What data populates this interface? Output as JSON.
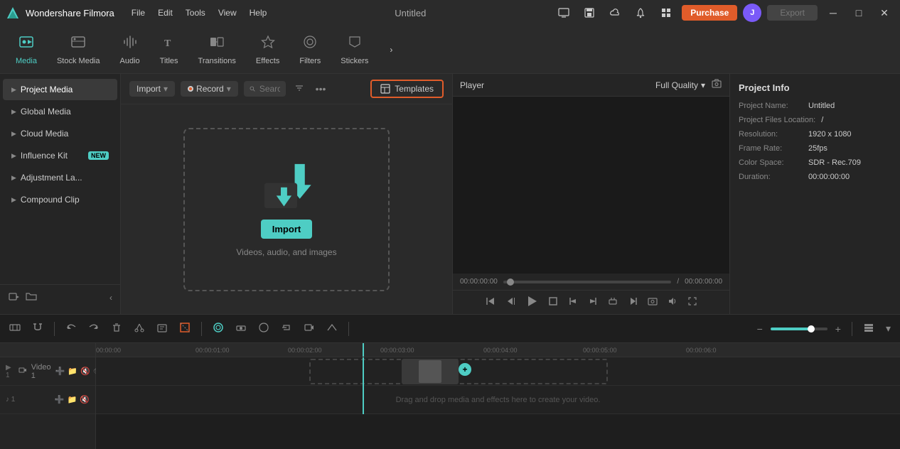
{
  "app": {
    "name": "Wondershare Filmora",
    "title": "Untitled"
  },
  "titlebar": {
    "menu": [
      "File",
      "Edit",
      "Tools",
      "View",
      "Help"
    ],
    "purchase_label": "Purchase",
    "export_label": "Export",
    "user_initial": "J",
    "win_controls": [
      "–",
      "□",
      "✕"
    ]
  },
  "toolbar": {
    "items": [
      {
        "id": "media",
        "icon": "⬛",
        "label": "Media",
        "active": true
      },
      {
        "id": "stock-media",
        "icon": "🎬",
        "label": "Stock Media"
      },
      {
        "id": "audio",
        "icon": "♪",
        "label": "Audio"
      },
      {
        "id": "titles",
        "icon": "T",
        "label": "Titles"
      },
      {
        "id": "transitions",
        "icon": "◧",
        "label": "Transitions"
      },
      {
        "id": "effects",
        "icon": "✦",
        "label": "Effects"
      },
      {
        "id": "filters",
        "icon": "◉",
        "label": "Filters"
      },
      {
        "id": "stickers",
        "icon": "★",
        "label": "Stickers"
      }
    ],
    "more_icon": "›"
  },
  "sidebar": {
    "items": [
      {
        "id": "project-media",
        "label": "Project Media",
        "active": true
      },
      {
        "id": "global-media",
        "label": "Global Media"
      },
      {
        "id": "cloud-media",
        "label": "Cloud Media"
      },
      {
        "id": "influence-kit",
        "label": "Influence Kit",
        "badge": "NEW"
      },
      {
        "id": "adjustment-la",
        "label": "Adjustment La..."
      },
      {
        "id": "compound-clip",
        "label": "Compound Clip"
      }
    ],
    "bottom_icons": [
      "➕",
      "📁"
    ]
  },
  "content_toolbar": {
    "import_label": "Import",
    "record_label": "Record",
    "search_placeholder": "Search media",
    "templates_label": "Templates"
  },
  "import_area": {
    "import_btn_label": "Import",
    "subtext": "Videos, audio, and images"
  },
  "player": {
    "label": "Player",
    "quality": "Full Quality",
    "time_current": "00:00:00:00",
    "time_separator": "/",
    "time_total": "00:00:00:00"
  },
  "project_info": {
    "title": "Project Info",
    "fields": [
      {
        "label": "Project Name:",
        "value": "Untitled"
      },
      {
        "label": "Project Files Location:",
        "value": "/"
      },
      {
        "label": "Resolution:",
        "value": "1920 x 1080"
      },
      {
        "label": "Frame Rate:",
        "value": "25fps"
      },
      {
        "label": "Color Space:",
        "value": "SDR - Rec.709"
      },
      {
        "label": "Duration:",
        "value": "00:00:00:00"
      }
    ]
  },
  "timeline": {
    "ruler_marks": [
      "00:00:00",
      "00:00:01:00",
      "00:00:02:00",
      "00:00:03:00",
      "00:00:04:00",
      "00:00:05:00",
      "00:00:06:0"
    ],
    "tracks": [
      {
        "id": "video1",
        "label": "Video 1",
        "icon": "▶"
      },
      {
        "id": "audio1",
        "label": "",
        "icon": "♪"
      }
    ],
    "drag_drop_text": "Drag and drop media and effects here to create your video."
  }
}
